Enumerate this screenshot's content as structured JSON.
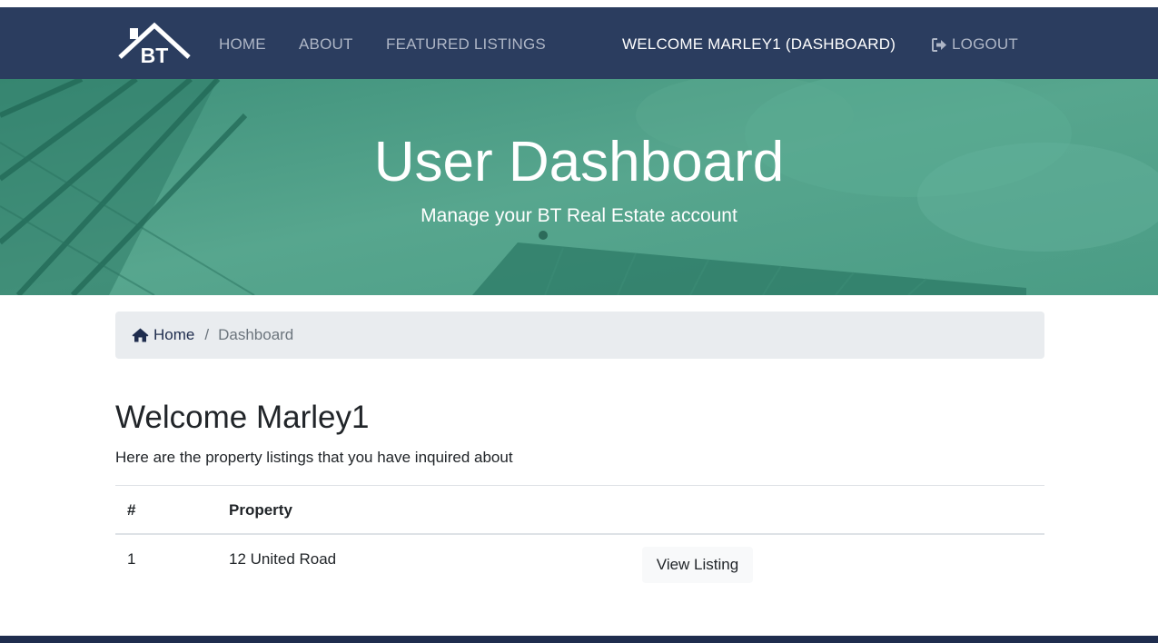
{
  "colors": {
    "navbar": "#2b3d5f",
    "hero": "#4e9e88",
    "breadcrumb_bg": "#e9ecef",
    "footer": "#1f2d4e"
  },
  "navbar": {
    "brand_text": "BT",
    "links": [
      "HOME",
      "ABOUT",
      "FEATURED LISTINGS"
    ],
    "welcome": "WELCOME MARLEY1 (DASHBOARD)",
    "logout": "LOGOUT",
    "logout_icon": "sign-out-icon"
  },
  "hero": {
    "title": "User Dashboard",
    "subtitle": "Manage your BT Real Estate account"
  },
  "breadcrumb": {
    "home": "Home",
    "home_icon": "home-icon",
    "separator": "/",
    "current": "Dashboard"
  },
  "main": {
    "heading": "Welcome Marley1",
    "intro": "Here are the property listings that you have inquired about"
  },
  "table": {
    "headers": [
      "#",
      "Property"
    ],
    "rows": [
      {
        "num": "1",
        "property": "12 United Road",
        "action": "View Listing"
      }
    ]
  }
}
